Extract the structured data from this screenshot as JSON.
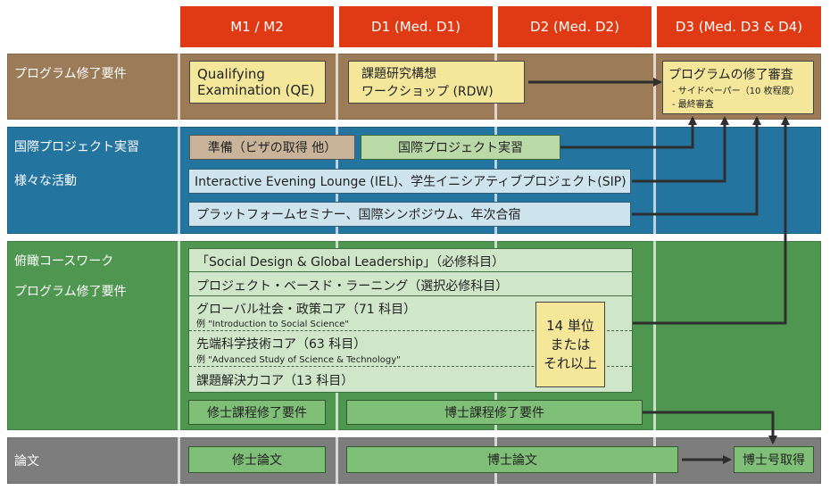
{
  "colors": {
    "header": "#e03a14",
    "row1": "#9b7b58",
    "row2": "#2474a0",
    "row3": "#4f9650",
    "row4": "#7d7d7d",
    "yellow_box": "#f4e79a",
    "arrow": "#2e2e2e"
  },
  "headers": [
    "M1 / M2",
    "D1 (Med. D1)",
    "D2 (Med. D2)",
    "D3 (Med. D3 & D4)"
  ],
  "rows": {
    "r1": {
      "label": "プログラム修了要件"
    },
    "r2": {
      "label1": "国際プロジェクト実習",
      "label2": "様々な活動"
    },
    "r3": {
      "label1": "俯瞰コースワーク",
      "label2": "プログラム修了要件"
    },
    "r4": {
      "label": "論文"
    }
  },
  "boxes": {
    "qe": {
      "line1": "Qualifying",
      "line2": "Examination (QE)"
    },
    "rdw": {
      "line1": "課題研究構想",
      "line2": "ワークショップ (RDW)"
    },
    "final": {
      "title": "プログラムの修了審査",
      "bullet1": "- サイドペーパー（10 枚程度）",
      "bullet2": "- 最終審査"
    },
    "prep": "準備（ビザの取得 他）",
    "intl": "国際プロジェクト実習",
    "iel": "Interactive Evening Lounge (IEL)、学生イニシアティブプロジェクト(SIP)",
    "platform": "プラットフォームセミナー、国際シンポジウム、年次合宿",
    "sdgl": "「Social Design & Global Leadership」（必修科目）",
    "pbl": "プロジェクト・ベースド・ラーニング（選択必修科目）",
    "global": {
      "title": "グローバル社会・政策コア（71 科目）",
      "example": "例 \"Introduction to Social Science\""
    },
    "advanced": {
      "title": "先端科学技術コア（63 科目）",
      "example": "例 \"Advanced Study of Science & Technology\""
    },
    "problem": "課題解決力コア（13 科目）",
    "units": {
      "line1": "14 単位",
      "line2": "または",
      "line3": "それ以上"
    },
    "master_req": "修士課程修了要件",
    "doctor_req": "博士課程修了要件",
    "master_thesis": "修士論文",
    "doctor_thesis": "博士論文",
    "phd": "博士号取得"
  }
}
